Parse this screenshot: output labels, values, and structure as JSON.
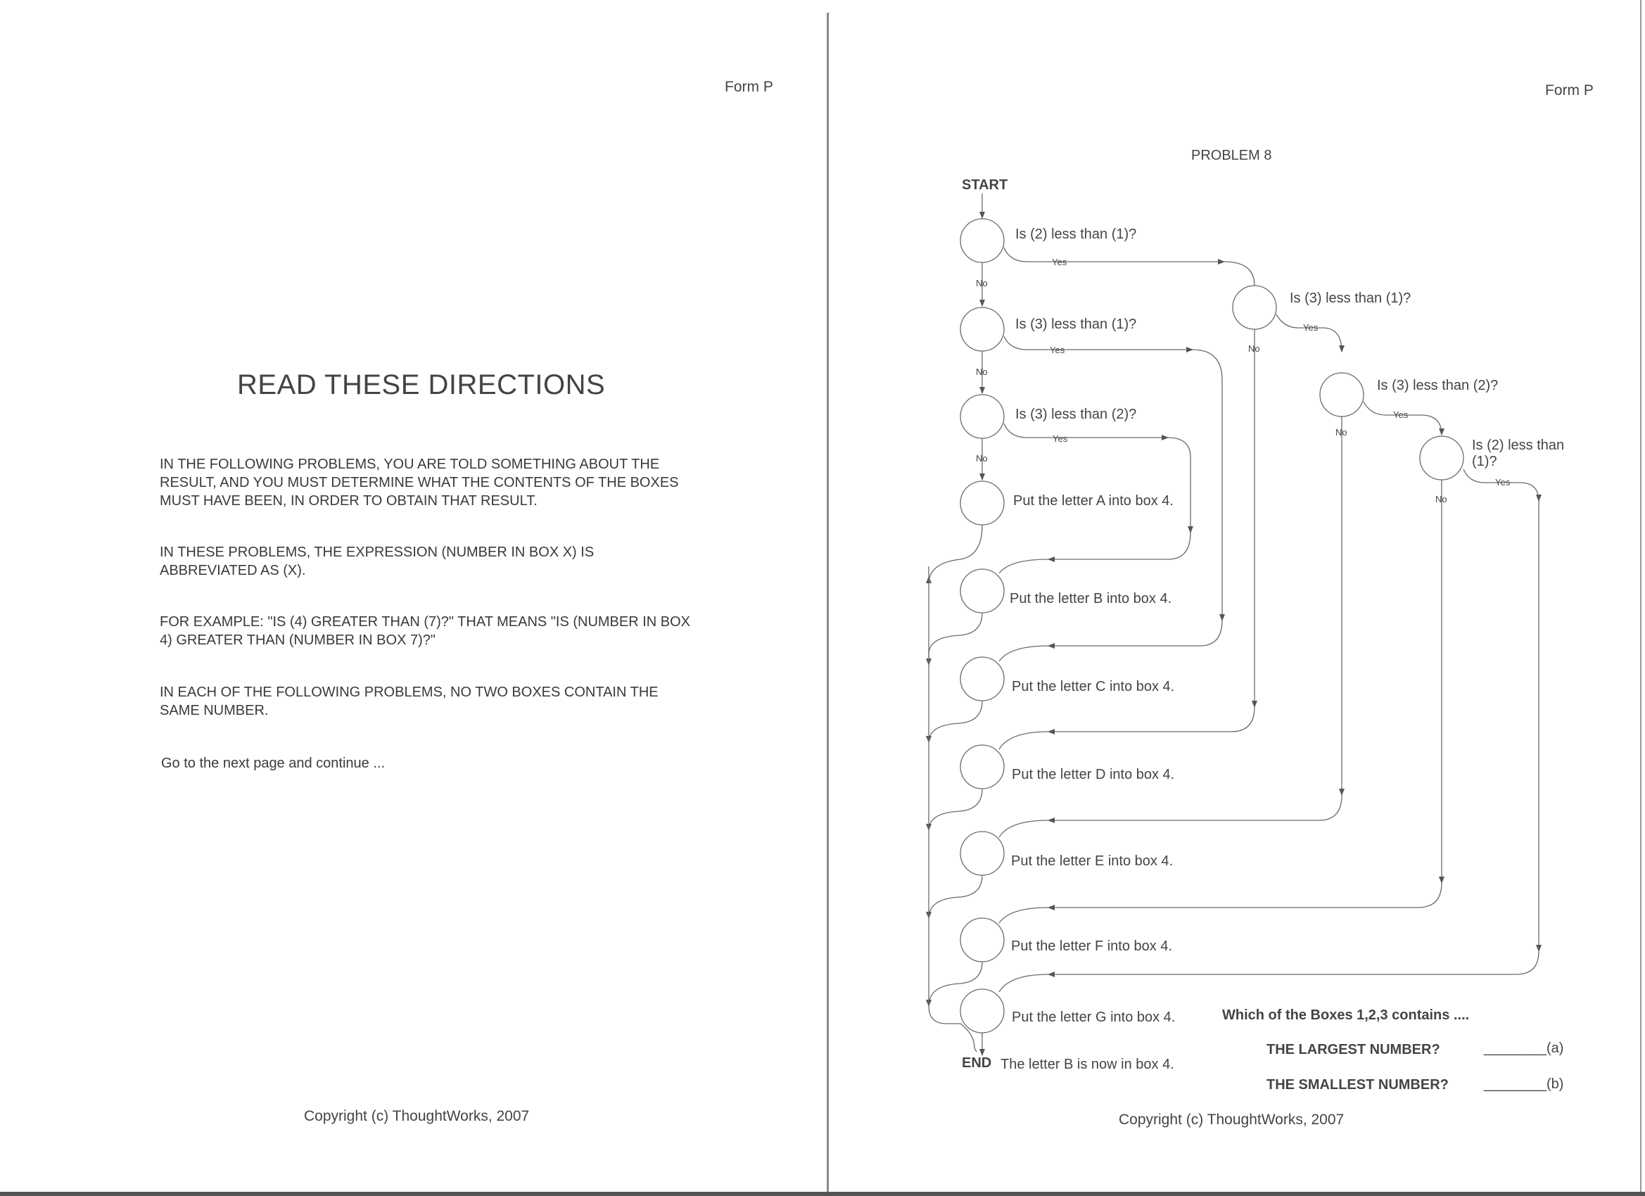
{
  "left": {
    "form_label": "Form P",
    "title": "READ THESE DIRECTIONS",
    "paragraphs": [
      "IN THE FOLLOWING PROBLEMS, YOU ARE TOLD SOMETHING ABOUT THE RESULT, AND YOU MUST DETERMINE WHAT THE CONTENTS OF THE BOXES MUST HAVE BEEN, IN ORDER TO OBTAIN THAT RESULT.",
      "IN THESE PROBLEMS, THE EXPRESSION (NUMBER IN BOX X) IS ABBREVIATED AS (X).",
      "FOR EXAMPLE: \"IS (4) GREATER THAN (7)?\"  THAT MEANS \"IS (NUMBER IN BOX 4) GREATER THAN (NUMBER IN BOX 7)?\"",
      "IN EACH OF THE FOLLOWING PROBLEMS, NO TWO BOXES CONTAIN THE SAME NUMBER.",
      "Go to the next page and continue ..."
    ],
    "copyright": "Copyright (c) ThoughtWorks, 2007"
  },
  "right": {
    "form_label": "Form P",
    "problem_title": "PROBLEM 8",
    "start_label": "START",
    "end_label": "END",
    "end_note": "The letter B is now in box 4.",
    "yes_label": "Yes",
    "no_label": "No",
    "decisions": [
      "Is (2) less than (1)?",
      "Is (3) less than (1)?",
      "Is (3) less than (2)?",
      "Is (3) less than (1)?",
      "Is (3) less than (2)?",
      "Is (2) less than",
      "(1)?"
    ],
    "actions": [
      "Put the letter A into box 4.",
      "Put the letter B into box 4.",
      "Put the letter C into box 4.",
      "Put the letter D into box 4.",
      "Put the letter E into box 4.",
      "Put the letter F into box 4.",
      "Put the letter G into box 4."
    ],
    "question": {
      "prompt": "Which of the Boxes 1,2,3 contains ....",
      "largest": "THE LARGEST NUMBER?",
      "smallest": "THE SMALLEST NUMBER?",
      "answer_a": "________(a)",
      "answer_b": "________(b)"
    },
    "copyright": "Copyright (c) ThoughtWorks, 2007"
  }
}
